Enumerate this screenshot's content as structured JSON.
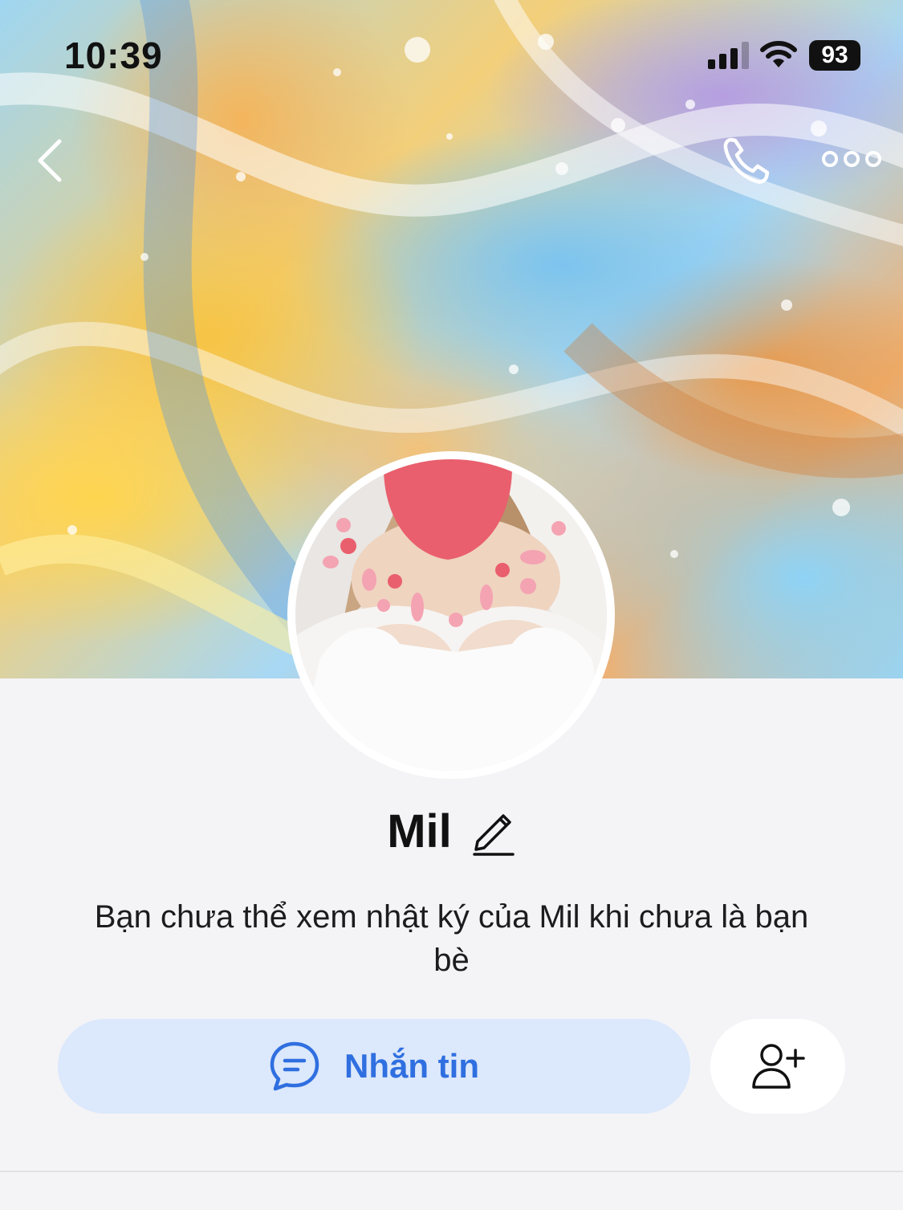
{
  "status_bar": {
    "time": "10:39",
    "battery": "93"
  },
  "icons": {
    "back": "chevron-left-icon",
    "call": "phone-icon",
    "more": "more-horizontal-icon",
    "edit": "pencil-icon",
    "message": "chat-bubble-icon",
    "add_friend": "add-user-icon"
  },
  "profile": {
    "name": "Mil",
    "notice": "Bạn chưa thể xem nhật ký của Mil khi chưa là bạn bè"
  },
  "actions": {
    "message_label": "Nhắn tin"
  },
  "colors": {
    "accent": "#2f6fe0",
    "message_button_bg": "#dce8fb",
    "page_bg": "#f4f4f7"
  }
}
